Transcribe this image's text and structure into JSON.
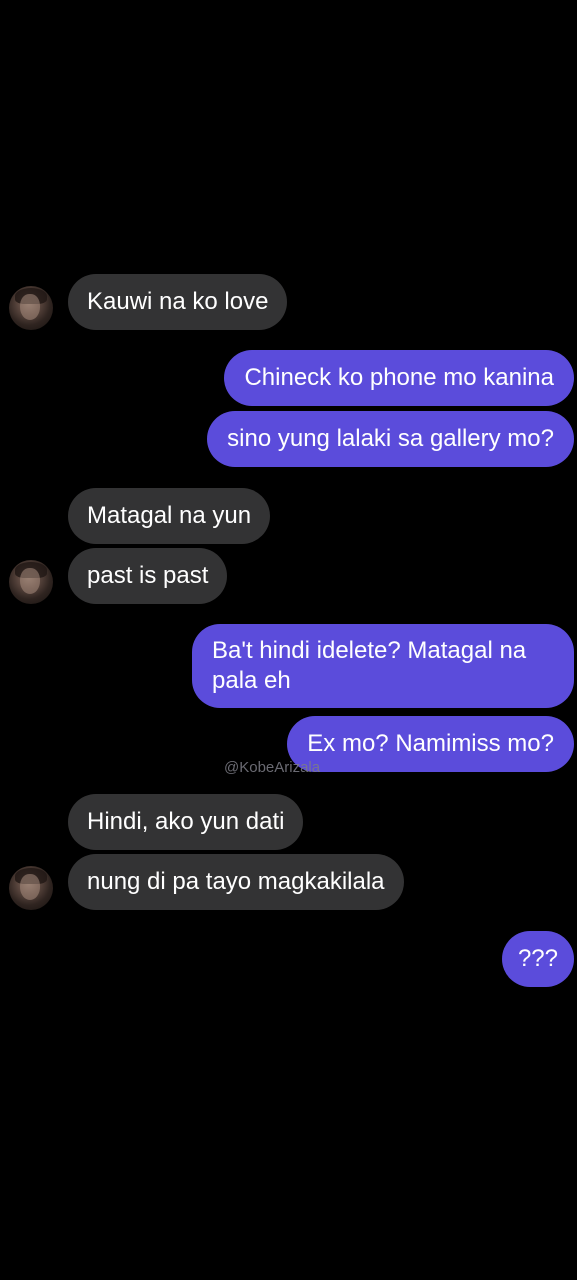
{
  "watermark": "@KobeArizala",
  "messages": [
    {
      "from": "them",
      "text": "Kauwi na ko love"
    },
    {
      "from": "me",
      "text": "Chineck ko phone mo kanina"
    },
    {
      "from": "me",
      "text": "sino yung lalaki sa gallery mo?"
    },
    {
      "from": "them",
      "text": "Matagal na yun"
    },
    {
      "from": "them",
      "text": "past is past"
    },
    {
      "from": "me",
      "text": "Ba't hindi idelete? Matagal na pala eh"
    },
    {
      "from": "me",
      "text": "Ex mo? Namimiss mo?"
    },
    {
      "from": "them",
      "text": "Hindi, ako yun dati"
    },
    {
      "from": "them",
      "text": "nung di pa tayo magkakilala"
    },
    {
      "from": "me",
      "text": "???"
    }
  ],
  "colors": {
    "background": "#000000",
    "incoming_bubble": "#333334",
    "outgoing_bubble": "#5b4cdb",
    "text": "#ffffff"
  }
}
